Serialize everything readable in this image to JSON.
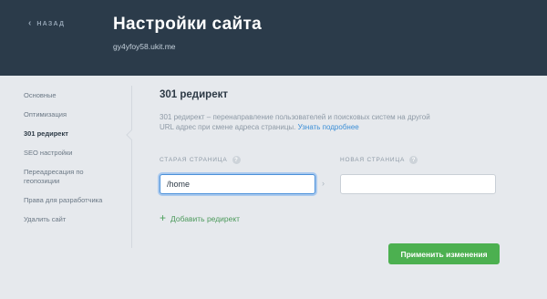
{
  "header": {
    "back_label": "НАЗАД",
    "title": "Настройки сайта",
    "domain": "gy4yfoy58.ukit.me"
  },
  "sidebar": {
    "items": [
      {
        "label": "Основные"
      },
      {
        "label": "Оптимизация"
      },
      {
        "label": "301 редирект",
        "active": true
      },
      {
        "label": "SEO настройки"
      },
      {
        "label": "Переадресация по геопозиции"
      },
      {
        "label": "Права для разработчика"
      },
      {
        "label": "Удалить сайт"
      }
    ]
  },
  "main": {
    "title": "301 редирект",
    "description": "301 редирект – перенаправление пользователей и поисковых систем на другой URL адрес при смене адреса страницы.",
    "learn_more": "Узнать подробнее",
    "old_page": {
      "label": "СТАРАЯ СТРАНИЦА",
      "help": "?",
      "value": "/home"
    },
    "new_page": {
      "label": "НОВАЯ СТРАНИЦА",
      "help": "?",
      "value": ""
    },
    "arrow": "›",
    "add_redirect": "Добавить редирект",
    "apply_button": "Применить изменения"
  },
  "colors": {
    "header_bg": "#2b3b4a",
    "page_bg": "#e6e9ed",
    "accent_green": "#4cb050",
    "link_blue": "#3d8fd6",
    "focus_blue": "#4a90d9"
  }
}
